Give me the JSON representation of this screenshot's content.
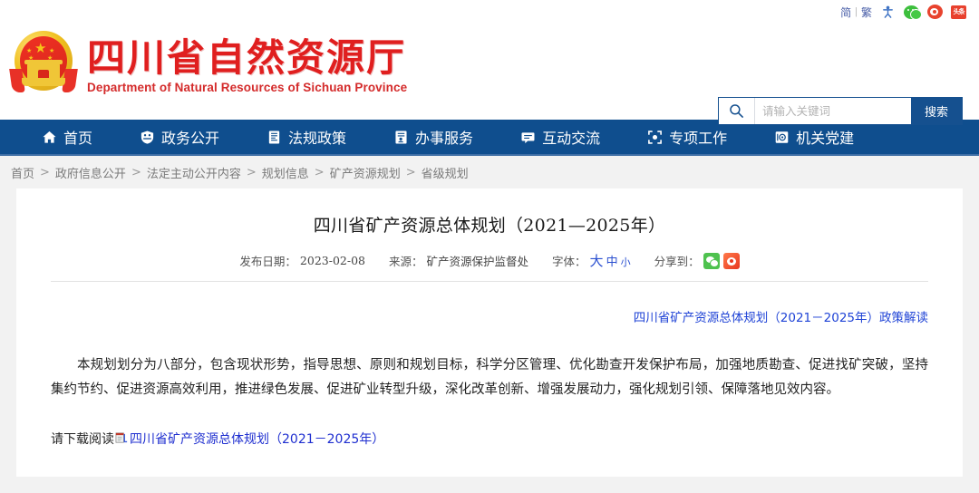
{
  "topbar": {
    "lang_simplified": "简",
    "lang_separator": "|",
    "lang_traditional": "繁",
    "icons": [
      "accessibility-icon",
      "wechat-icon",
      "weibo-icon",
      "toutiao-icon"
    ],
    "toutiao_label": "头条"
  },
  "header": {
    "logo_icon": "national-emblem-icon",
    "title_cn": "四川省自然资源厅",
    "title_en": "Department of Natural Resources of Sichuan Province",
    "brand_color": "#e01f1f"
  },
  "search": {
    "icon": "search-icon",
    "placeholder": "请输入关键词",
    "value": "",
    "button_label": "搜索",
    "accent_color": "#15508f"
  },
  "nav": {
    "background_color": "#0f4e8e",
    "items": [
      {
        "label": "首页",
        "icon": "home-icon"
      },
      {
        "label": "政务公开",
        "icon": "shield-icon"
      },
      {
        "label": "法规政策",
        "icon": "document-icon"
      },
      {
        "label": "办事服务",
        "icon": "service-form-icon"
      },
      {
        "label": "互动交流",
        "icon": "chat-bubble-icon"
      },
      {
        "label": "专项工作",
        "icon": "focus-target-icon"
      },
      {
        "label": "机关党建",
        "icon": "party-badge-icon"
      }
    ]
  },
  "breadcrumb": {
    "separator": ">",
    "items": [
      "首页",
      "政府信息公开",
      "法定主动公开内容",
      "规划信息",
      "矿产资源规划",
      "省级规划"
    ]
  },
  "article": {
    "title": "四川省矿产资源总体规划（2021—2025年）",
    "meta": {
      "date_label": "发布日期：",
      "date_value": "2023-02-08",
      "source_label": "来源：",
      "source_value": "矿产资源保护监督处",
      "font_label": "字体：",
      "font_large": "大",
      "font_medium": "中",
      "font_small": "小",
      "share_label": "分享到：",
      "share_icons": [
        "wechat-share-icon",
        "weibo-share-icon"
      ]
    },
    "interpretation_link": "四川省矿产资源总体规划（2021－2025年）政策解读",
    "body": "本规划划分为八部分，包含现状形势，指导思想、原则和规划目标，科学分区管理、优化勘查开发保护布局，加强地质勘查、促进找矿突破，坚持集约节约、促进资源高效利用，推进绿色发展、促进矿业转型升级，深化改革创新、增强发展动力，强化规划引领、保障落地见效内容。",
    "download": {
      "prefix": "请下载阅读",
      "icon": "attachment-file-icon",
      "link_text": "四川省矿产资源总体规划（2021－2025年）"
    }
  }
}
